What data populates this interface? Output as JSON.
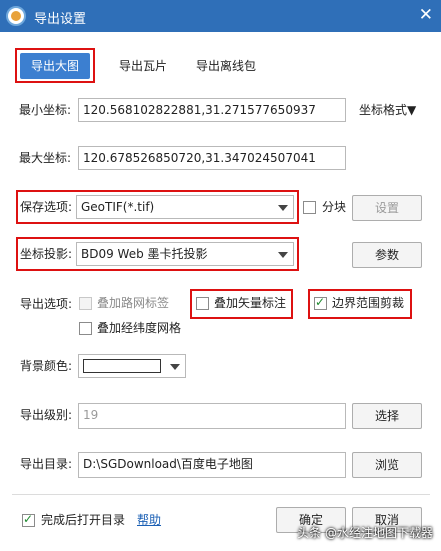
{
  "window": {
    "title": "导出设置",
    "close_glyph": "✕"
  },
  "tabs": {
    "export_image": "导出大图",
    "export_tiles": "导出瓦片",
    "export_offline": "导出离线包"
  },
  "coords": {
    "min_label": "最小坐标:",
    "min_value": "120.568102822881,31.271577650937",
    "max_label": "最大坐标:",
    "max_value": "120.678526850720,31.347024507041",
    "format_label": "坐标格式▼"
  },
  "save": {
    "label": "保存选项:",
    "value": "GeoTIF(*.tif)",
    "split_label": "分块",
    "settings_button": "设置"
  },
  "projection": {
    "label": "坐标投影:",
    "value": "BD09 Web 墨卡托投影",
    "params_button": "参数"
  },
  "export_options": {
    "label": "导出选项:",
    "road_labels": "叠加路网标签",
    "vector_labels": "叠加矢量标注",
    "boundary_clip": "边界范围剪裁",
    "lat_lon_grid": "叠加经纬度网格"
  },
  "background": {
    "label": "背景颜色:",
    "color": "#ffffff"
  },
  "level": {
    "label": "导出级别:",
    "value": "19",
    "select_button": "选择"
  },
  "directory": {
    "label": "导出目录:",
    "value": "D:\\SGDownload\\百度电子地图",
    "browse_button": "浏览"
  },
  "footer": {
    "open_after": "完成后打开目录",
    "help": "帮助",
    "ok": "确定",
    "cancel": "取消"
  },
  "watermark": "头条 @水经注地图下载器",
  "colors": {
    "titlebar": "#2f6fb8",
    "primary": "#3c7fd0",
    "highlight": "#dd1111"
  }
}
